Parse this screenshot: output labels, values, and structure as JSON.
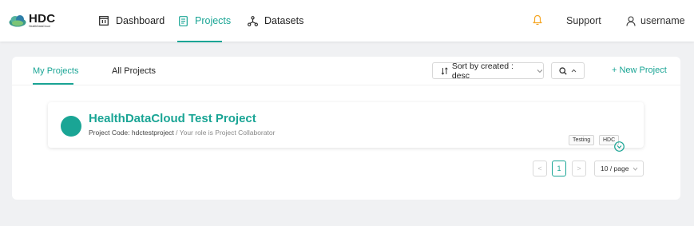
{
  "colors": {
    "accent": "#1aa595",
    "bell": "#f5a623",
    "background": "#f0f1f3"
  },
  "header": {
    "logo": {
      "title": "HDC",
      "subtitle": "HealthDataCloud"
    },
    "nav": [
      {
        "label": "Dashboard",
        "icon": "dashboard-icon"
      },
      {
        "label": "Projects",
        "icon": "projects-icon",
        "active": true
      },
      {
        "label": "Datasets",
        "icon": "datasets-icon"
      }
    ],
    "support_label": "Support",
    "username": "username"
  },
  "main": {
    "tabs": [
      {
        "label": "My Projects",
        "active": true
      },
      {
        "label": "All Projects"
      }
    ],
    "sort_label": "Sort by created : desc",
    "new_project_label": "+ New Project",
    "project": {
      "title": "HealthDataCloud Test Project",
      "code_text": "Project Code: hdctestproject",
      "role_text": " / Your role is Project Collaborator",
      "tags": [
        "Testing",
        "HDC"
      ]
    },
    "pagination": {
      "current_page": "1",
      "prev": "<",
      "next": ">",
      "page_size": "10 / page"
    }
  }
}
